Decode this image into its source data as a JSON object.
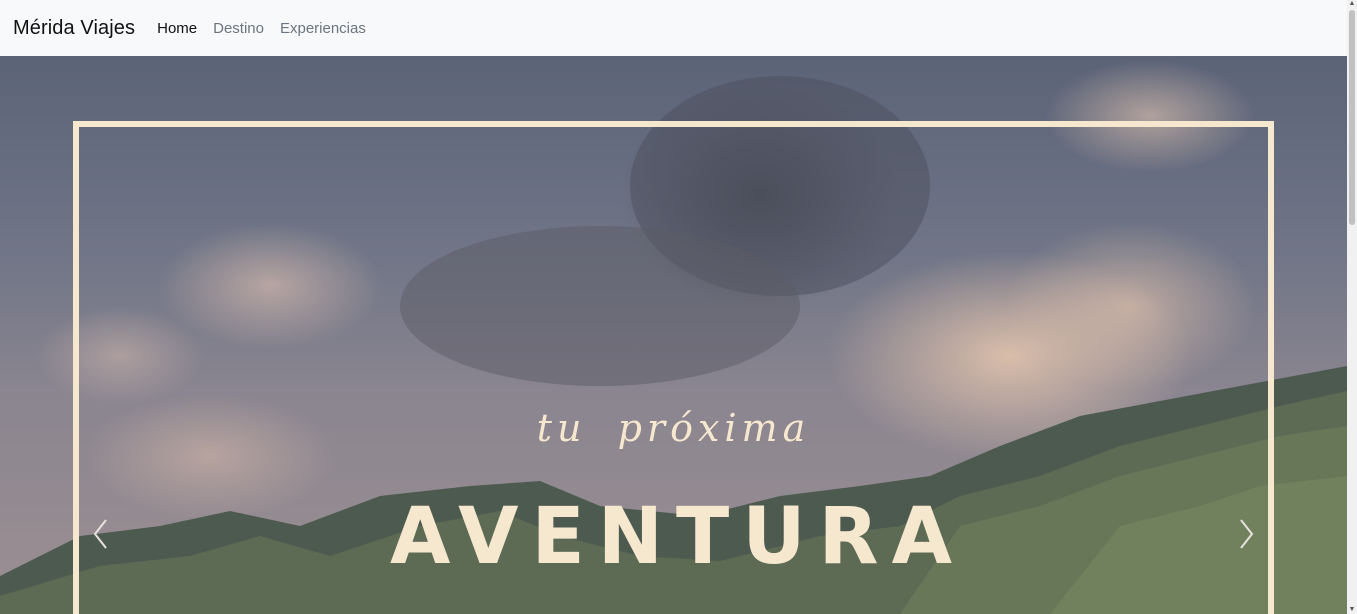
{
  "navbar": {
    "brand": "Mérida Viajes",
    "links": [
      {
        "label": "Home",
        "active": true
      },
      {
        "label": "Destino",
        "active": false
      },
      {
        "label": "Experiencias",
        "active": false
      }
    ]
  },
  "hero": {
    "subtitle": "tu próxima",
    "title": "AVENTURA",
    "prev_icon": "chevron-left-icon",
    "next_icon": "chevron-right-icon"
  },
  "colors": {
    "navbar_bg": "#f8f9fa",
    "accent_text": "#f6e7cf",
    "link_muted": "#6c757d",
    "link_active": "#111111"
  }
}
